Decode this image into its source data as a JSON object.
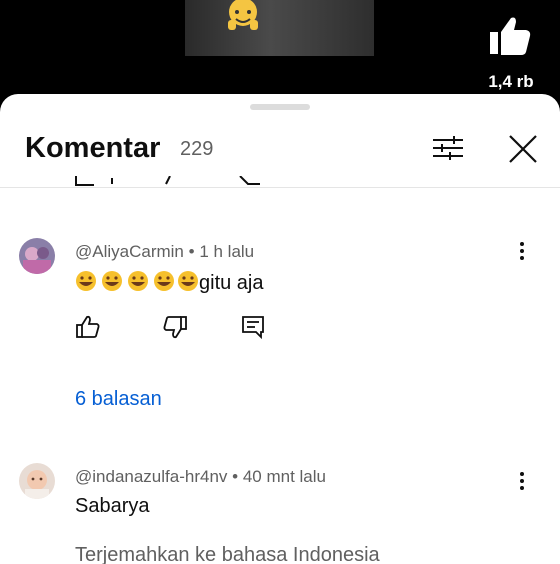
{
  "video": {
    "like_count": "1,4 rb"
  },
  "comments_sheet": {
    "title": "Komentar",
    "count": "229"
  },
  "comments": [
    {
      "author": "@AliyaCarmin",
      "time": "1 h lalu",
      "emojis": "🤣🤣🤣🤣🤣",
      "text": "gitu aja",
      "replies_label": "6 balasan"
    },
    {
      "author": "@indanazulfa-hr4nv",
      "time": "40 mnt lalu",
      "text": "Sabarya",
      "translate_label": "Terjemahkan ke bahasa Indonesia"
    }
  ],
  "colors": {
    "link": "#065fd4",
    "secondary_text": "#606060",
    "primary_text": "#0f0f0f"
  }
}
